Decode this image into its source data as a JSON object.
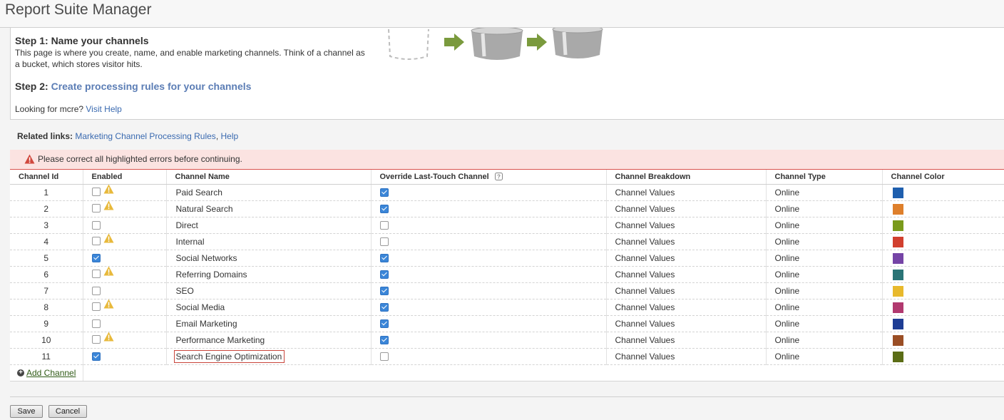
{
  "app": {
    "title": "Report Suite Manager"
  },
  "intro": {
    "step1_heading": "Step 1: Name your channels",
    "step1_desc": "This page is where you create, name, and enable marketing channels. Think of a channel as a bucket, which stores visitor hits.",
    "step2_prefix": "Step 2: ",
    "step2_link": "Create processing rules for your channels",
    "looking_prefix": "Looking for mcre? ",
    "looking_link": "Visit Help"
  },
  "related": {
    "label": "Related links:",
    "link1": "Marketing Channel Processing Rules",
    "separator": ",",
    "link2": "Help"
  },
  "error": {
    "message": "Please correct all highlighted errors before continuing."
  },
  "table": {
    "headers": {
      "id": "Channel Id",
      "enabled": "Enabled",
      "name": "Channel Name",
      "override": "Override Last-Touch Channel",
      "breakdown": "Channel Breakdown",
      "type": "Channel Type",
      "color": "Channel Color"
    },
    "rows": [
      {
        "id": "1",
        "enabled": false,
        "warning": true,
        "name": "Paid Search",
        "override": true,
        "breakdown": "Channel Values",
        "type": "Online",
        "color": "#1f5fae"
      },
      {
        "id": "2",
        "enabled": false,
        "warning": true,
        "name": "Natural Search",
        "override": true,
        "breakdown": "Channel Values",
        "type": "Online",
        "color": "#de7f2b"
      },
      {
        "id": "3",
        "enabled": false,
        "warning": false,
        "name": "Direct",
        "override": false,
        "breakdown": "Channel Values",
        "type": "Online",
        "color": "#7a9a1b"
      },
      {
        "id": "4",
        "enabled": false,
        "warning": true,
        "name": "Internal",
        "override": false,
        "breakdown": "Channel Values",
        "type": "Online",
        "color": "#d13f2e"
      },
      {
        "id": "5",
        "enabled": true,
        "warning": false,
        "name": "Social Networks",
        "override": true,
        "breakdown": "Channel Values",
        "type": "Online",
        "color": "#7544a6"
      },
      {
        "id": "6",
        "enabled": false,
        "warning": true,
        "name": "Referring Domains",
        "override": true,
        "breakdown": "Channel Values",
        "type": "Online",
        "color": "#2a7476"
      },
      {
        "id": "7",
        "enabled": false,
        "warning": false,
        "name": "SEO",
        "override": true,
        "breakdown": "Channel Values",
        "type": "Online",
        "color": "#e8b92c"
      },
      {
        "id": "8",
        "enabled": false,
        "warning": true,
        "name": "Social Media",
        "override": true,
        "breakdown": "Channel Values",
        "type": "Online",
        "color": "#b1396f"
      },
      {
        "id": "9",
        "enabled": false,
        "warning": false,
        "name": "Email Marketing",
        "override": true,
        "breakdown": "Channel Values",
        "type": "Online",
        "color": "#1e3d94"
      },
      {
        "id": "10",
        "enabled": false,
        "warning": true,
        "name": "Performance Marketing",
        "override": true,
        "breakdown": "Channel Values",
        "type": "Online",
        "color": "#9a4e25"
      },
      {
        "id": "11",
        "enabled": true,
        "warning": false,
        "name": "Search Engine Optimization",
        "override": false,
        "breakdown": "Channel Values",
        "type": "Online",
        "color": "#5b6d16",
        "name_error": true
      }
    ]
  },
  "add_channel": {
    "label": "Add Channel"
  },
  "buttons": {
    "save": "Save",
    "cancel": "Cancel"
  },
  "icons": {
    "warning": "warning-triangle-icon",
    "help": "help-icon",
    "add": "plus-circle-icon",
    "error": "error-triangle-icon"
  },
  "colors": {
    "accent_link": "#3a6ab0",
    "error_bg": "#fbe3e1",
    "error_border": "#d9534f",
    "checkbox_on": "#3b86d8"
  }
}
